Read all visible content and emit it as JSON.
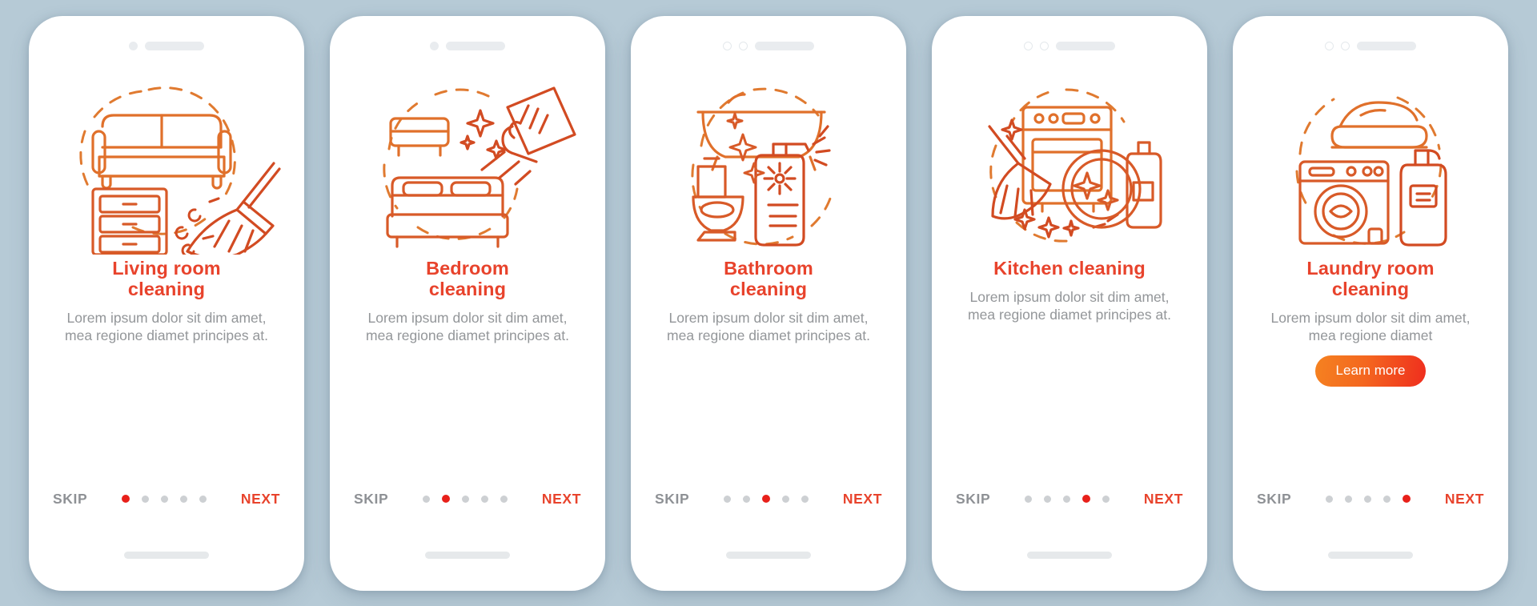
{
  "background_color": "#b6cad6",
  "accent_color": "#e8432c",
  "muted_color": "#939699",
  "nav": {
    "skip_label": "SKIP",
    "next_label": "NEXT"
  },
  "cards": [
    {
      "icon": "sofa-broom-dresser-icon",
      "title_line1": "Living room",
      "title_line2": "cleaning",
      "desc_line1": "Lorem ipsum dolor sit dim",
      "desc_line2": "amet, mea regione diamet",
      "desc_line3": "principes at.",
      "active_dot": 1,
      "cta_label": ""
    },
    {
      "icon": "bed-wipe-icon",
      "title_line1": "Bedroom",
      "title_line2": "cleaning",
      "desc_line1": "Lorem ipsum dolor sit dim",
      "desc_line2": "amet, mea regione diamet",
      "desc_line3": "principes at.",
      "active_dot": 2,
      "cta_label": ""
    },
    {
      "icon": "bathtub-toilet-spray-icon",
      "title_line1": "Bathroom",
      "title_line2": "cleaning",
      "desc_line1": "Lorem ipsum dolor sit dim",
      "desc_line2": "amet, mea regione diamet",
      "desc_line3": "principes at.",
      "active_dot": 3,
      "cta_label": ""
    },
    {
      "icon": "stove-mop-detergent-icon",
      "title_line1": "Kitchen cleaning",
      "title_line2": "",
      "desc_line1": "Lorem ipsum dolor sit dim",
      "desc_line2": "amet, mea regione diamet",
      "desc_line3": "principes at.",
      "active_dot": 4,
      "cta_label": ""
    },
    {
      "icon": "washer-iron-detergent-icon",
      "title_line1": "Laundry room",
      "title_line2": "cleaning",
      "desc_line1": "Lorem ipsum dolor sit dim",
      "desc_line2": "amet, mea regione diamet",
      "desc_line3": "",
      "active_dot": 5,
      "cta_label": "Learn more"
    }
  ]
}
